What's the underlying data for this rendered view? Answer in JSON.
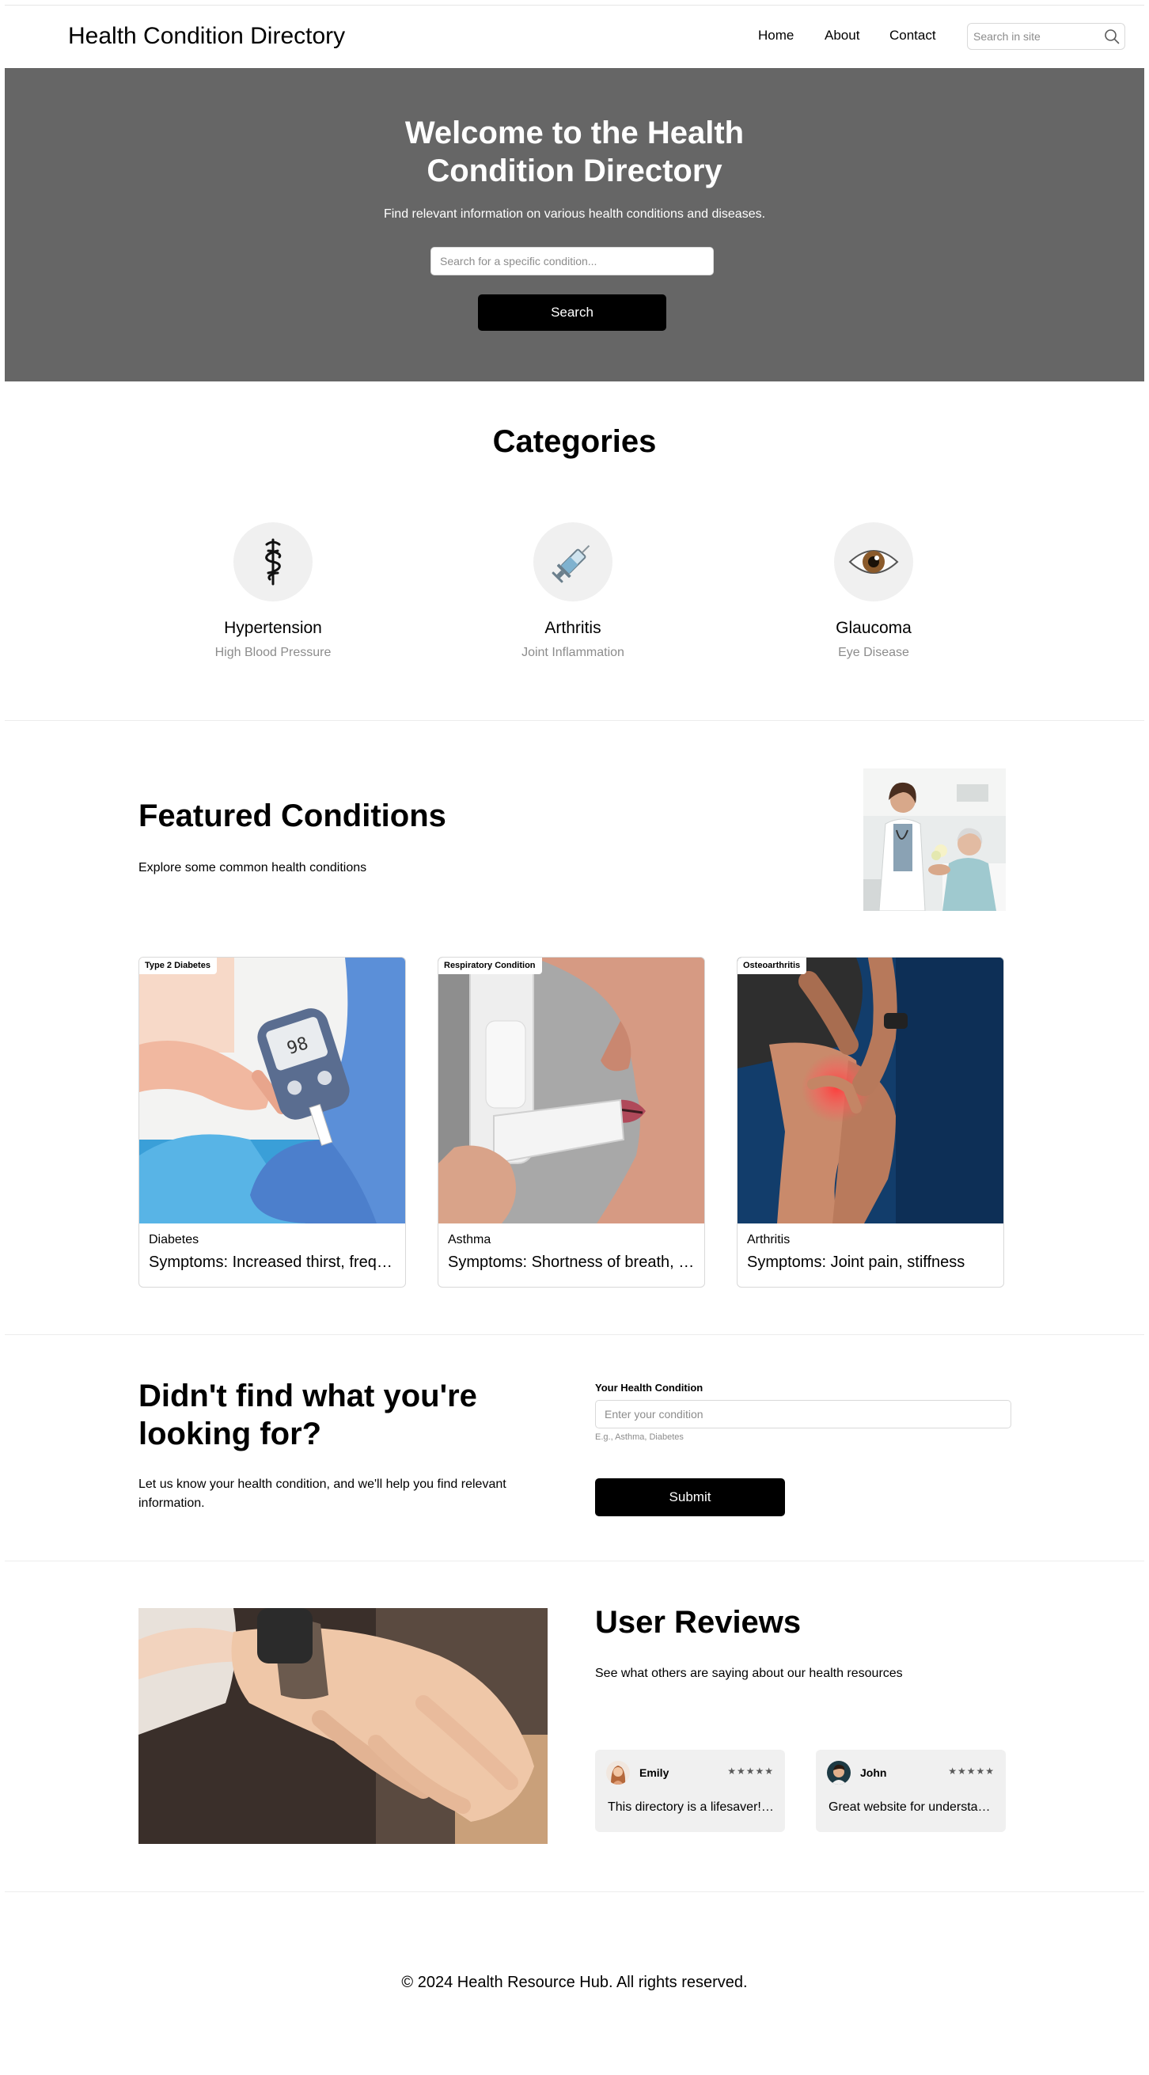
{
  "header": {
    "title": "Health Condition Directory",
    "nav": [
      "Home",
      "About",
      "Contact"
    ],
    "search_placeholder": "Search in site"
  },
  "hero": {
    "title": "Welcome to the Health Condition Directory",
    "subtitle": "Find relevant information on various health conditions and diseases.",
    "search_placeholder": "Search for a specific condition...",
    "button": "Search"
  },
  "categories": {
    "heading": "Categories",
    "items": [
      {
        "name": "Hypertension",
        "desc": "High Blood Pressure",
        "icon": "caduceus-icon"
      },
      {
        "name": "Arthritis",
        "desc": "Joint Inflammation",
        "icon": "syringe-icon"
      },
      {
        "name": "Glaucoma",
        "desc": "Eye Disease",
        "icon": "eye-icon"
      }
    ]
  },
  "featured": {
    "heading": "Featured Conditions",
    "subtitle": "Explore some common health conditions",
    "cards": [
      {
        "tag": "Type 2 Diabetes",
        "title": "Diabetes",
        "symptoms": "Symptoms: Increased thirst, frequent urination"
      },
      {
        "tag": "Respiratory Condition",
        "title": "Asthma",
        "symptoms": "Symptoms: Shortness of breath, wheezing"
      },
      {
        "tag": "Osteoarthritis",
        "title": "Arthritis",
        "symptoms": "Symptoms: Joint pain, stiffness"
      }
    ]
  },
  "request": {
    "heading": "Didn't find what you're looking for?",
    "subtitle": "Let us know your health condition, and we'll help you find relevant information.",
    "label": "Your Health Condition",
    "placeholder": "Enter your condition",
    "help": "E.g., Asthma, Diabetes",
    "button": "Submit"
  },
  "reviews": {
    "heading": "User Reviews",
    "subtitle": "See what others are saying about our health resources",
    "items": [
      {
        "name": "Emily",
        "rating": 5,
        "stars": "★★★★★",
        "text": "This directory is a lifesaver! I found everything I needed."
      },
      {
        "name": "John",
        "rating": 5,
        "stars": "★★★★★",
        "text": "Great website for understanding health conditions."
      }
    ]
  },
  "footer": {
    "text": "© 2024 Health Resource Hub. All rights reserved."
  }
}
